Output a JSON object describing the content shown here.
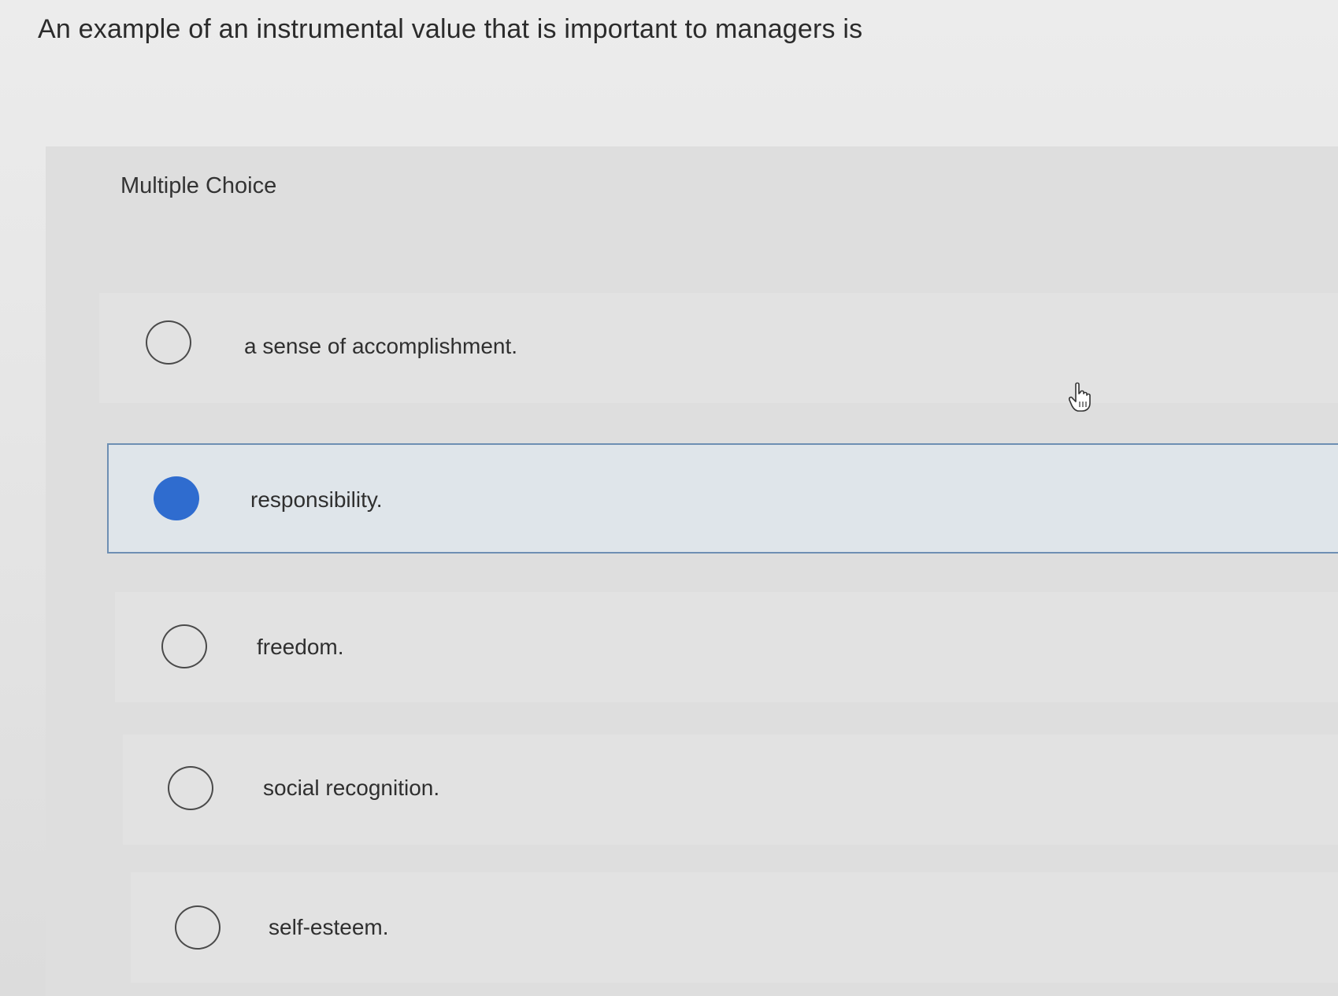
{
  "question": {
    "text": "An example of an instrumental value that is important to managers is"
  },
  "panel": {
    "label": "Multiple Choice"
  },
  "options": [
    {
      "label": "a sense of accomplishment.",
      "selected": false
    },
    {
      "label": "responsibility.",
      "selected": true
    },
    {
      "label": "freedom.",
      "selected": false
    },
    {
      "label": "social recognition.",
      "selected": false
    },
    {
      "label": "self-esteem.",
      "selected": false
    }
  ],
  "colors": {
    "selected_accent": "#2f6ccf",
    "selected_border": "#6e8fb3"
  },
  "icons": {
    "cursor": "hand-pointer-icon"
  }
}
